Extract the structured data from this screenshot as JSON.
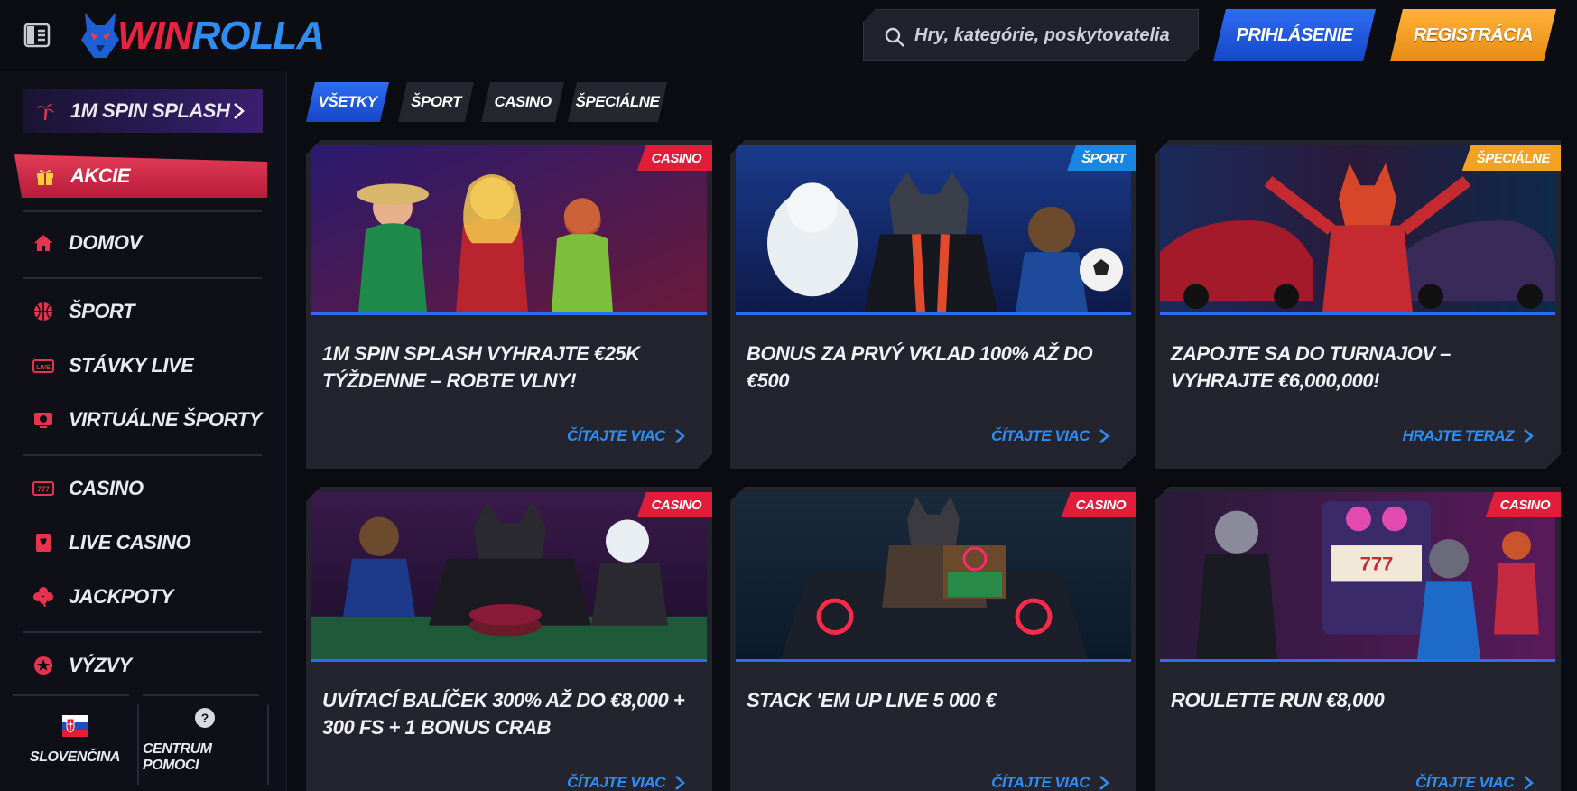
{
  "header": {
    "logo_text_1": "WIN",
    "logo_text_2": "ROLLA",
    "search_placeholder": "Hry, kategórie, poskytovatelia",
    "login_label": "PRIHLÁSENIE",
    "register_label": "REGISTRÁCIA"
  },
  "sidebar": {
    "promo_label": "1M SPIN SPLASH",
    "active_label": "AKCIE",
    "items": [
      {
        "label": "DOMOV",
        "icon": "home-icon"
      },
      {
        "label": "ŠPORT",
        "icon": "basketball-icon"
      },
      {
        "label": "STÁVKY LIVE",
        "icon": "live-icon"
      },
      {
        "label": "VIRTUÁLNE ŠPORTY",
        "icon": "virtual-sports-icon"
      },
      {
        "label": "CASINO",
        "icon": "slot-icon"
      },
      {
        "label": "LIVE CASINO",
        "icon": "card-icon"
      },
      {
        "label": "JACKPOTY",
        "icon": "clover-icon"
      },
      {
        "label": "VÝZVY",
        "icon": "badge-star-icon"
      }
    ],
    "language_label": "SLOVENČINA",
    "help_label": "CENTRUM POMOCI"
  },
  "filters": [
    "VŠETKY",
    "ŠPORT",
    "CASINO",
    "ŠPECIÁLNE"
  ],
  "cards": [
    {
      "badge": "CASINO",
      "title": "1M SPIN SPLASH VYHRAJTE €25K TÝŽDENNE – ROBTE VLNY!",
      "link": "ČÍTAJTE VIAC"
    },
    {
      "badge": "ŠPORT",
      "title": "BONUS ZA PRVÝ VKLAD 100% AŽ DO €500",
      "link": "ČÍTAJTE VIAC"
    },
    {
      "badge": "ŠPECIÁLNE",
      "title": "ZAPOJTE SA DO TURNAJOV – VYHRAJTE €6,000,000!",
      "link": "HRAJTE TERAZ"
    },
    {
      "badge": "CASINO",
      "title": "UVÍTACÍ BALÍČEK 300% AŽ DO €8,000 + 300 FS + 1 BONUS CRAB",
      "link": "ČÍTAJTE VIAC"
    },
    {
      "badge": "CASINO",
      "title": "STACK 'EM UP LIVE 5 000 €",
      "link": "ČÍTAJTE VIAC"
    },
    {
      "badge": "CASINO",
      "title": "ROULETTE RUN €8,000",
      "link": "ČÍTAJTE VIAC"
    }
  ],
  "colors": {
    "accent_blue": "#2e6cf3",
    "accent_red": "#e11d3a",
    "accent_orange": "#f2a324",
    "link_blue": "#2e8df2"
  }
}
